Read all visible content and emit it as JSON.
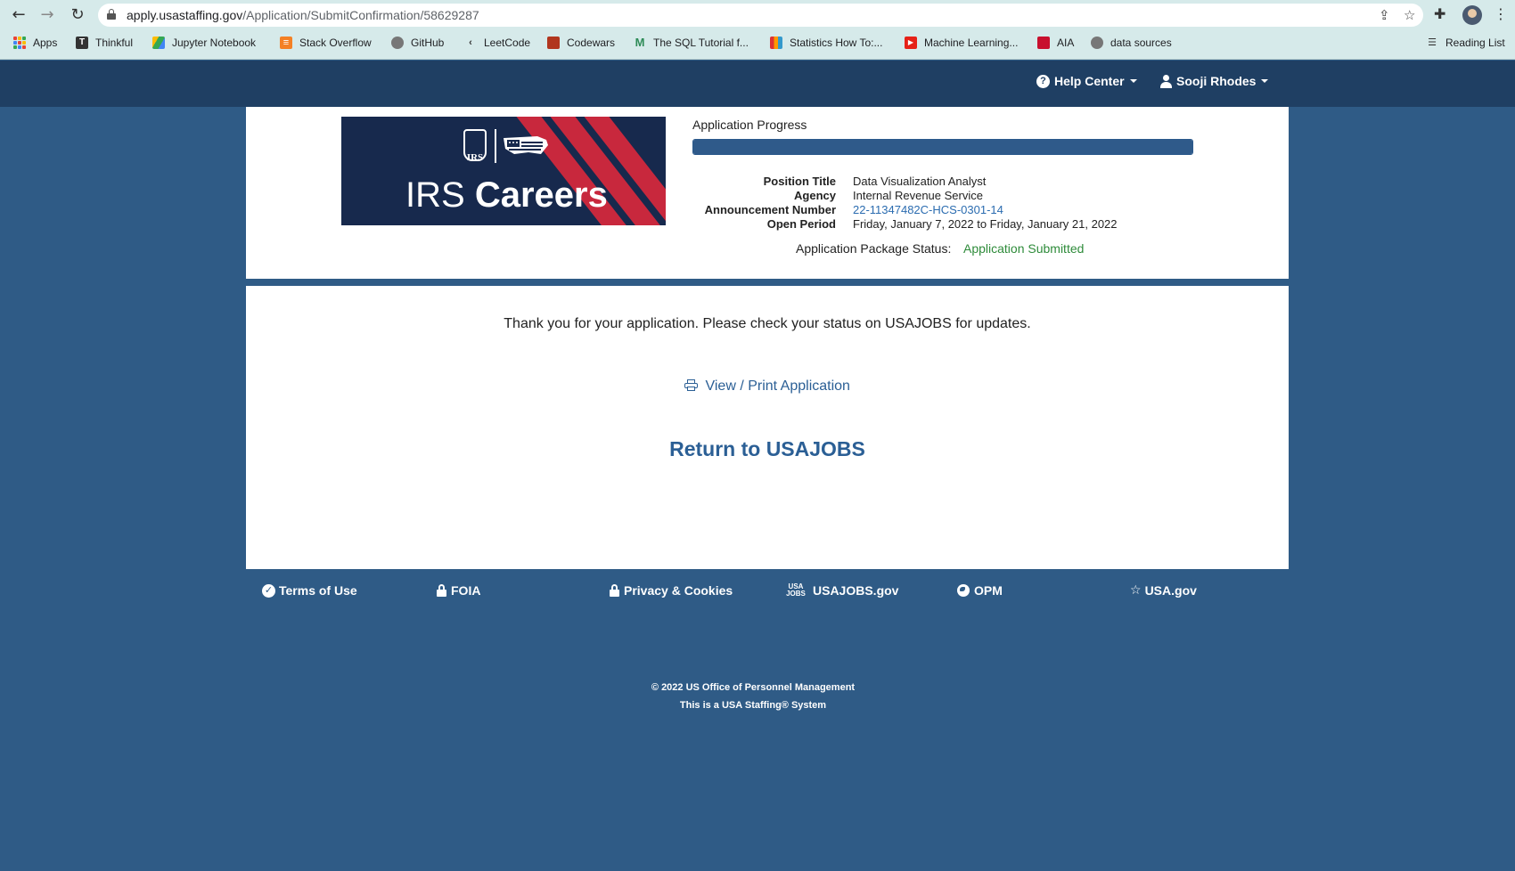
{
  "browser": {
    "url_domain": "apply.usastaffing.gov",
    "url_path": "/Application/SubmitConfirmation/58629287",
    "bookmarks": [
      {
        "label": "Apps",
        "icon": "apps-grid-icon"
      },
      {
        "label": "Thinkful",
        "icon": "thinkful-icon"
      },
      {
        "label": "Jupyter Notebook",
        "icon": "google-drive-icon"
      },
      {
        "label": "Stack Overflow",
        "icon": "stack-overflow-icon"
      },
      {
        "label": "GitHub",
        "icon": "github-icon"
      },
      {
        "label": "LeetCode",
        "icon": "leetcode-icon"
      },
      {
        "label": "Codewars",
        "icon": "codewars-icon"
      },
      {
        "label": "The SQL Tutorial f...",
        "icon": "sql-tutorial-icon"
      },
      {
        "label": "Statistics How To:...",
        "icon": "statistics-icon"
      },
      {
        "label": "Machine Learning...",
        "icon": "youtube-icon"
      },
      {
        "label": "AIA",
        "icon": "aia-icon"
      },
      {
        "label": "data sources",
        "icon": "github-icon"
      }
    ],
    "reading_list": "Reading List"
  },
  "header": {
    "help_center": "Help Center",
    "user_name": "Sooji Rhodes"
  },
  "logo": {
    "seal_text": "IRS",
    "brand_light": "IRS",
    "brand_bold": "Careers"
  },
  "application": {
    "progress_label": "Application Progress",
    "progress_fraction": 1.0,
    "fields": [
      {
        "key": "Position Title",
        "value": "Data Visualization Analyst"
      },
      {
        "key": "Agency",
        "value": "Internal Revenue Service"
      },
      {
        "key": "Announcement Number",
        "value": "22-11347482C-HCS-0301-14"
      },
      {
        "key": "Open Period",
        "value": "Friday, January 7, 2022 to Friday, January 21, 2022"
      }
    ],
    "package_status_label": "Application Package Status:",
    "package_status_value": "Application Submitted"
  },
  "main": {
    "thanks_text": "Thank you for your application. Please check your status on USAJOBS for updates.",
    "view_print": "View / Print Application",
    "return_link": "Return to USAJOBS"
  },
  "footer": {
    "links": [
      {
        "label": "Terms of Use",
        "icon": "check-circle-icon"
      },
      {
        "label": "FOIA",
        "icon": "lock-icon"
      },
      {
        "label": "Privacy & Cookies",
        "icon": "lock-icon"
      },
      {
        "label": "USAJOBS.gov",
        "icon": "usajobs-icon"
      },
      {
        "label": "OPM",
        "icon": "globe-icon"
      },
      {
        "label": "USA.gov",
        "icon": "star-icon"
      }
    ],
    "usajobs_icon_text_top": "USA",
    "usajobs_icon_text_bottom": "JOBS",
    "copyright_line1": "© 2022 US Office of Personnel Management",
    "copyright_line2": "This is a USA Staffing® System"
  },
  "colors": {
    "page_background": "#2f5b86",
    "header_background": "#1f3f63",
    "link_blue": "#2b5f95",
    "status_green": "#2e8b3a",
    "irs_navy": "#17294d",
    "irs_red": "#c8283d"
  }
}
